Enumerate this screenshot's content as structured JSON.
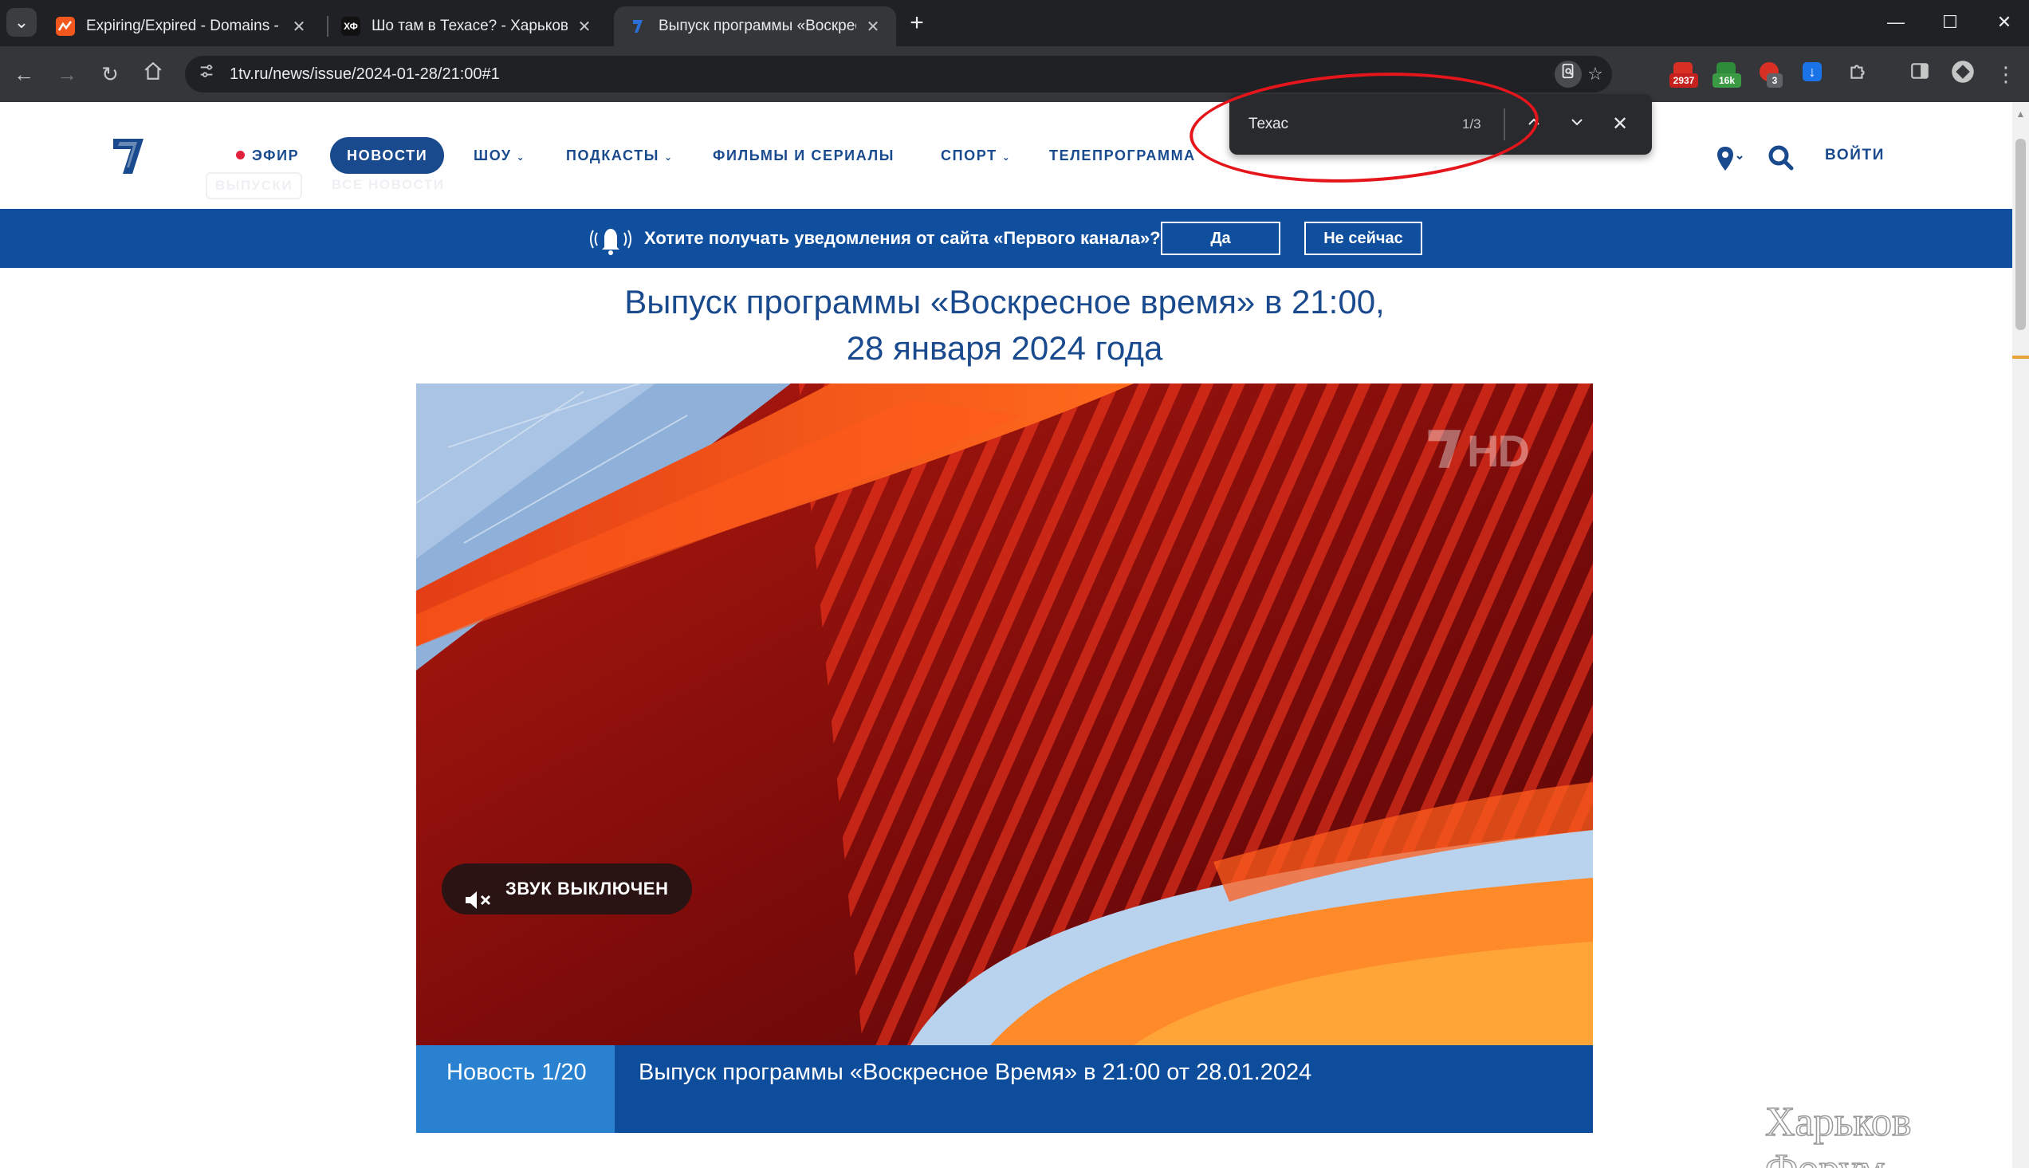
{
  "browser": {
    "tabs": [
      {
        "title": "Expiring/Expired - Domains - M",
        "active": false,
        "favicon_color": "#f2571d"
      },
      {
        "title": "Шо там в Техасе? - Харьков Ф",
        "active": false,
        "favicon_color": "#111111"
      },
      {
        "title": "Выпуск программы «Воскресн",
        "active": true,
        "favicon_color": "#1a4a8e"
      }
    ],
    "second_tab_favicon_text": "ХФ",
    "url": "1tv.ru/news/issue/2024-01-28/21:00#1",
    "extensions": [
      {
        "name": "mail",
        "badge": "2937",
        "color": "#d93025"
      },
      {
        "name": "counter",
        "badge": "16k",
        "color": "#2e8b3a"
      },
      {
        "name": "adblock",
        "badge": "3",
        "color": "#d93025"
      },
      {
        "name": "download",
        "badge": "",
        "color": "#1a73e8"
      }
    ]
  },
  "find_bar": {
    "query": "Техас",
    "count": "1/3"
  },
  "site": {
    "nav": {
      "live": "ЭФИР",
      "news": "НОВОСТИ",
      "shows": "ШОУ",
      "podcasts": "ПОДКАСТЫ",
      "films": "ФИЛЬМЫ И СЕРИАЛЫ",
      "sport": "СПОРТ",
      "tv_guide": "ТЕЛЕПРОГРАММА",
      "login": "ВОЙТИ"
    },
    "subnav": {
      "issues": "ВЫПУСКИ",
      "all_news": "ВСЕ НОВОСТИ"
    },
    "notification": {
      "text": "Хотите получать уведомления от сайта «Первого канала»?",
      "yes": "Да",
      "no": "Не сейчас"
    },
    "page_title_line1": "Выпуск программы «Воскресное время» в 21:00,",
    "page_title_line2": "28 января 2024 года",
    "video": {
      "mute_label": "ЗВУК ВЫКЛЮЧЕН",
      "channel_badge": "HD"
    },
    "caption": {
      "counter": "Новость 1/20",
      "title": "Выпуск программы «Воскресное Время» в 21:00 от 28.01.2024"
    }
  },
  "watermark": "Харьков Форум",
  "colors": {
    "brand_blue": "#1a4a8e",
    "notify_blue": "#0f4f9e",
    "caption_light_blue": "#2a81cf",
    "annotation_red": "#e5161b",
    "live_dot": "#e2213d"
  }
}
